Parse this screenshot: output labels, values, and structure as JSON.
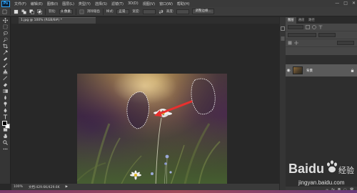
{
  "menubar": {
    "logo": "Ps",
    "items": [
      "文件(F)",
      "编辑(E)",
      "图像(I)",
      "图层(L)",
      "类型(Y)",
      "选择(S)",
      "滤镜(T)",
      "3D(D)",
      "视图(V)",
      "窗口(W)",
      "帮助(H)"
    ],
    "controls": [
      "—",
      "□",
      "✕"
    ]
  },
  "options": {
    "feather_label": "羽化:",
    "feather_value": "0 像素",
    "antialias_label": "消除锯齿",
    "style_label": "样式:",
    "style_value": "正常",
    "width_label": "宽度:",
    "height_label": "高度:",
    "refine_button": "调整边缘..."
  },
  "document": {
    "tab_title": "1.jpg @ 100% (RGB/8#) *"
  },
  "panels": {
    "tabs": [
      "图层",
      "通道",
      "路径"
    ],
    "layer_name": "背景"
  },
  "status": {
    "zoom": "100%",
    "doc_size": "文档:429.6K/429.6K"
  },
  "watermark": {
    "logo": "Baidu",
    "jingyan": "经验",
    "url": "jingyan.baidu.com"
  }
}
